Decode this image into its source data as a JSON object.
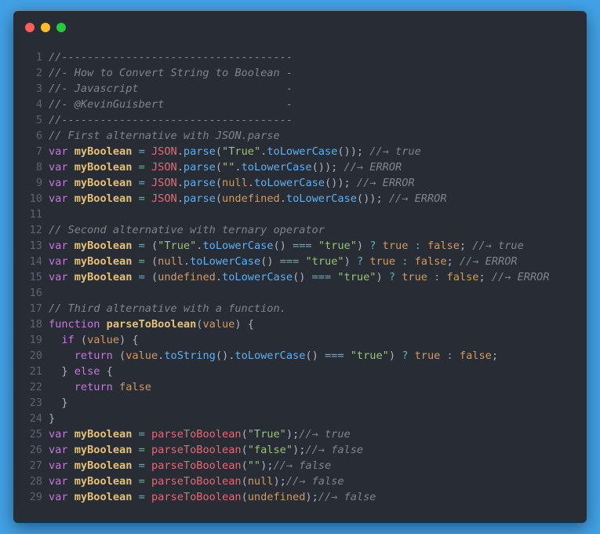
{
  "window": {
    "controls": [
      {
        "name": "close-button",
        "color": "#ff5f56"
      },
      {
        "name": "minimize-button",
        "color": "#ffbd2e"
      },
      {
        "name": "zoom-button",
        "color": "#27c93f"
      }
    ]
  },
  "code": {
    "language": "javascript",
    "lines": [
      {
        "n": "1",
        "tokens": [
          [
            "cm",
            "//------------------------------------"
          ]
        ]
      },
      {
        "n": "2",
        "tokens": [
          [
            "cm",
            "//- How to Convert String to Boolean -"
          ]
        ]
      },
      {
        "n": "3",
        "tokens": [
          [
            "cm",
            "//- Javascript                       -"
          ]
        ]
      },
      {
        "n": "4",
        "tokens": [
          [
            "cm",
            "//- @KevinGuisbert                   -"
          ]
        ]
      },
      {
        "n": "5",
        "tokens": [
          [
            "cm",
            "//------------------------------------"
          ]
        ]
      },
      {
        "n": "6",
        "tokens": [
          [
            "cm",
            "// First alternative with JSON.parse"
          ]
        ]
      },
      {
        "n": "7",
        "tokens": [
          [
            "kw",
            "var"
          ],
          [
            "pl",
            " "
          ],
          [
            "vn",
            "myBoolean"
          ],
          [
            "pl",
            " "
          ],
          [
            "op",
            "="
          ],
          [
            "pl",
            " "
          ],
          [
            "fn",
            "JSON"
          ],
          [
            "pl",
            "."
          ],
          [
            "me",
            "parse"
          ],
          [
            "pl",
            "("
          ],
          [
            "st",
            "\"True\""
          ],
          [
            "pl",
            "."
          ],
          [
            "me",
            "toLowerCase"
          ],
          [
            "pl",
            "()); "
          ],
          [
            "cm",
            "//→ true"
          ]
        ]
      },
      {
        "n": "8",
        "tokens": [
          [
            "kw",
            "var"
          ],
          [
            "pl",
            " "
          ],
          [
            "vn",
            "myBoolean"
          ],
          [
            "pl",
            " "
          ],
          [
            "op",
            "="
          ],
          [
            "pl",
            " "
          ],
          [
            "fn",
            "JSON"
          ],
          [
            "pl",
            "."
          ],
          [
            "me",
            "parse"
          ],
          [
            "pl",
            "("
          ],
          [
            "st",
            "\"\""
          ],
          [
            "pl",
            "."
          ],
          [
            "me",
            "toLowerCase"
          ],
          [
            "pl",
            "()); "
          ],
          [
            "cm",
            "//→ ERROR"
          ]
        ]
      },
      {
        "n": "9",
        "tokens": [
          [
            "kw",
            "var"
          ],
          [
            "pl",
            " "
          ],
          [
            "vn",
            "myBoolean"
          ],
          [
            "pl",
            " "
          ],
          [
            "op",
            "="
          ],
          [
            "pl",
            " "
          ],
          [
            "fn",
            "JSON"
          ],
          [
            "pl",
            "."
          ],
          [
            "me",
            "parse"
          ],
          [
            "pl",
            "("
          ],
          [
            "kc",
            "null"
          ],
          [
            "pl",
            "."
          ],
          [
            "me",
            "toLowerCase"
          ],
          [
            "pl",
            "()); "
          ],
          [
            "cm",
            "//→ ERROR"
          ]
        ]
      },
      {
        "n": "10",
        "tokens": [
          [
            "kw",
            "var"
          ],
          [
            "pl",
            " "
          ],
          [
            "vn",
            "myBoolean"
          ],
          [
            "pl",
            " "
          ],
          [
            "op",
            "="
          ],
          [
            "pl",
            " "
          ],
          [
            "fn",
            "JSON"
          ],
          [
            "pl",
            "."
          ],
          [
            "me",
            "parse"
          ],
          [
            "pl",
            "("
          ],
          [
            "kc",
            "undefined"
          ],
          [
            "pl",
            "."
          ],
          [
            "me",
            "toLowerCase"
          ],
          [
            "pl",
            "()); "
          ],
          [
            "cm",
            "//→ ERROR"
          ]
        ]
      },
      {
        "n": "11",
        "tokens": []
      },
      {
        "n": "12",
        "tokens": [
          [
            "cm",
            "// Second alternative with ternary operator"
          ]
        ]
      },
      {
        "n": "13",
        "tokens": [
          [
            "kw",
            "var"
          ],
          [
            "pl",
            " "
          ],
          [
            "vn",
            "myBoolean"
          ],
          [
            "pl",
            " "
          ],
          [
            "op",
            "="
          ],
          [
            "pl",
            " ("
          ],
          [
            "st",
            "\"True\""
          ],
          [
            "pl",
            "."
          ],
          [
            "me",
            "toLowerCase"
          ],
          [
            "pl",
            "() "
          ],
          [
            "op",
            "==="
          ],
          [
            "pl",
            " "
          ],
          [
            "st",
            "\"true\""
          ],
          [
            "pl",
            ") "
          ],
          [
            "op",
            "?"
          ],
          [
            "pl",
            " "
          ],
          [
            "kc",
            "true"
          ],
          [
            "pl",
            " "
          ],
          [
            "op",
            ":"
          ],
          [
            "pl",
            " "
          ],
          [
            "kc",
            "false"
          ],
          [
            "pl",
            "; "
          ],
          [
            "cm",
            "//→ true"
          ]
        ]
      },
      {
        "n": "14",
        "tokens": [
          [
            "kw",
            "var"
          ],
          [
            "pl",
            " "
          ],
          [
            "vn",
            "myBoolean"
          ],
          [
            "pl",
            " "
          ],
          [
            "op",
            "="
          ],
          [
            "pl",
            " ("
          ],
          [
            "kc",
            "null"
          ],
          [
            "pl",
            "."
          ],
          [
            "me",
            "toLowerCase"
          ],
          [
            "pl",
            "() "
          ],
          [
            "op",
            "==="
          ],
          [
            "pl",
            " "
          ],
          [
            "st",
            "\"true\""
          ],
          [
            "pl",
            ") "
          ],
          [
            "op",
            "?"
          ],
          [
            "pl",
            " "
          ],
          [
            "kc",
            "true"
          ],
          [
            "pl",
            " "
          ],
          [
            "op",
            ":"
          ],
          [
            "pl",
            " "
          ],
          [
            "kc",
            "false"
          ],
          [
            "pl",
            "; "
          ],
          [
            "cm",
            "//→ ERROR"
          ]
        ]
      },
      {
        "n": "15",
        "tokens": [
          [
            "kw",
            "var"
          ],
          [
            "pl",
            " "
          ],
          [
            "vn",
            "myBoolean"
          ],
          [
            "pl",
            " "
          ],
          [
            "op",
            "="
          ],
          [
            "pl",
            " ("
          ],
          [
            "kc",
            "undefined"
          ],
          [
            "pl",
            "."
          ],
          [
            "me",
            "toLowerCase"
          ],
          [
            "pl",
            "() "
          ],
          [
            "op",
            "==="
          ],
          [
            "pl",
            " "
          ],
          [
            "st",
            "\"true\""
          ],
          [
            "pl",
            ") "
          ],
          [
            "op",
            "?"
          ],
          [
            "pl",
            " "
          ],
          [
            "kc",
            "true"
          ],
          [
            "pl",
            " "
          ],
          [
            "op",
            ":"
          ],
          [
            "pl",
            " "
          ],
          [
            "kc",
            "false"
          ],
          [
            "pl",
            "; "
          ],
          [
            "cm",
            "//→ ERROR"
          ]
        ]
      },
      {
        "n": "16",
        "tokens": []
      },
      {
        "n": "17",
        "tokens": [
          [
            "cm",
            "// Third alternative with a function."
          ]
        ]
      },
      {
        "n": "18",
        "tokens": [
          [
            "kw",
            "function"
          ],
          [
            "pl",
            " "
          ],
          [
            "vn",
            "parseToBoolean"
          ],
          [
            "pl",
            "("
          ],
          [
            "kc",
            "value"
          ],
          [
            "pl",
            ") {"
          ]
        ]
      },
      {
        "n": "19",
        "tokens": [
          [
            "pl",
            "  "
          ],
          [
            "kw",
            "if"
          ],
          [
            "pl",
            " ("
          ],
          [
            "kc",
            "value"
          ],
          [
            "pl",
            ") {"
          ]
        ]
      },
      {
        "n": "20",
        "tokens": [
          [
            "pl",
            "    "
          ],
          [
            "kw",
            "return"
          ],
          [
            "pl",
            " ("
          ],
          [
            "kc",
            "value"
          ],
          [
            "pl",
            "."
          ],
          [
            "me",
            "toString"
          ],
          [
            "pl",
            "()."
          ],
          [
            "me",
            "toLowerCase"
          ],
          [
            "pl",
            "() "
          ],
          [
            "op",
            "==="
          ],
          [
            "pl",
            " "
          ],
          [
            "st",
            "\"true\""
          ],
          [
            "pl",
            ") "
          ],
          [
            "op",
            "?"
          ],
          [
            "pl",
            " "
          ],
          [
            "kc",
            "true"
          ],
          [
            "pl",
            " "
          ],
          [
            "op",
            ":"
          ],
          [
            "pl",
            " "
          ],
          [
            "kc",
            "false"
          ],
          [
            "pl",
            ";"
          ]
        ]
      },
      {
        "n": "21",
        "tokens": [
          [
            "pl",
            "  } "
          ],
          [
            "kw",
            "else"
          ],
          [
            "pl",
            " {"
          ]
        ]
      },
      {
        "n": "22",
        "tokens": [
          [
            "pl",
            "    "
          ],
          [
            "kw",
            "return"
          ],
          [
            "pl",
            " "
          ],
          [
            "kc",
            "false"
          ]
        ]
      },
      {
        "n": "23",
        "tokens": [
          [
            "pl",
            "  }"
          ]
        ]
      },
      {
        "n": "24",
        "tokens": [
          [
            "pl",
            "}"
          ]
        ]
      },
      {
        "n": "25",
        "tokens": [
          [
            "kw",
            "var"
          ],
          [
            "pl",
            " "
          ],
          [
            "vn",
            "myBoolean"
          ],
          [
            "pl",
            " "
          ],
          [
            "op",
            "="
          ],
          [
            "pl",
            " "
          ],
          [
            "fn",
            "parseToBoolean"
          ],
          [
            "pl",
            "("
          ],
          [
            "st",
            "\"True\""
          ],
          [
            "pl",
            ");"
          ],
          [
            "cm",
            "//→ true"
          ]
        ]
      },
      {
        "n": "26",
        "tokens": [
          [
            "kw",
            "var"
          ],
          [
            "pl",
            " "
          ],
          [
            "vn",
            "myBoolean"
          ],
          [
            "pl",
            " "
          ],
          [
            "op",
            "="
          ],
          [
            "pl",
            " "
          ],
          [
            "fn",
            "parseToBoolean"
          ],
          [
            "pl",
            "("
          ],
          [
            "st",
            "\"false\""
          ],
          [
            "pl",
            ");"
          ],
          [
            "cm",
            "//→ false"
          ]
        ]
      },
      {
        "n": "27",
        "tokens": [
          [
            "kw",
            "var"
          ],
          [
            "pl",
            " "
          ],
          [
            "vn",
            "myBoolean"
          ],
          [
            "pl",
            " "
          ],
          [
            "op",
            "="
          ],
          [
            "pl",
            " "
          ],
          [
            "fn",
            "parseToBoolean"
          ],
          [
            "pl",
            "("
          ],
          [
            "st",
            "\"\""
          ],
          [
            "pl",
            ");"
          ],
          [
            "cm",
            "//→ false"
          ]
        ]
      },
      {
        "n": "28",
        "tokens": [
          [
            "kw",
            "var"
          ],
          [
            "pl",
            " "
          ],
          [
            "vn",
            "myBoolean"
          ],
          [
            "pl",
            " "
          ],
          [
            "op",
            "="
          ],
          [
            "pl",
            " "
          ],
          [
            "fn",
            "parseToBoolean"
          ],
          [
            "pl",
            "("
          ],
          [
            "kc",
            "null"
          ],
          [
            "pl",
            ");"
          ],
          [
            "cm",
            "//→ false"
          ]
        ]
      },
      {
        "n": "29",
        "tokens": [
          [
            "kw",
            "var"
          ],
          [
            "pl",
            " "
          ],
          [
            "vn",
            "myBoolean"
          ],
          [
            "pl",
            " "
          ],
          [
            "op",
            "="
          ],
          [
            "pl",
            " "
          ],
          [
            "fn",
            "parseToBoolean"
          ],
          [
            "pl",
            "("
          ],
          [
            "kc",
            "undefined"
          ],
          [
            "pl",
            ");"
          ],
          [
            "cm",
            "//→ false"
          ]
        ]
      }
    ]
  }
}
